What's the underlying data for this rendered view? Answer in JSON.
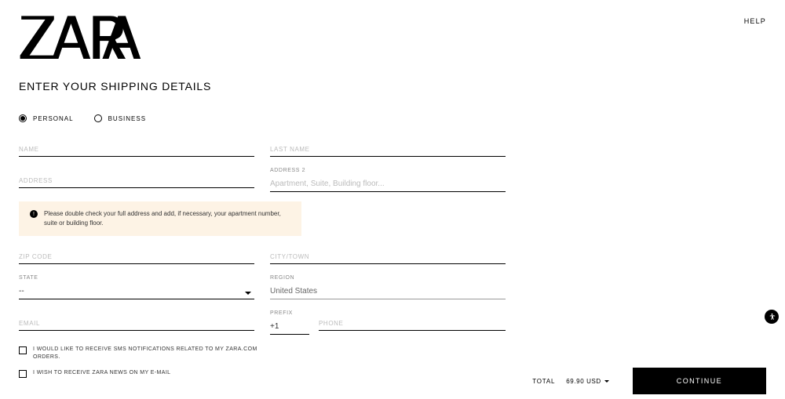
{
  "header": {
    "logo_text": "ZARA",
    "help": "HELP"
  },
  "page_title": "ENTER YOUR SHIPPING DETAILS",
  "account_type": {
    "personal": "PERSONAL",
    "business": "BUSINESS",
    "selected": "personal"
  },
  "fields": {
    "name_label": "NAME",
    "last_name_label": "LAST NAME",
    "address_label": "ADDRESS",
    "address2_label": "ADDRESS 2",
    "address2_placeholder": "Apartment, Suite, Building floor...",
    "zip_label": "ZIP CODE",
    "city_label": "CITY/TOWN",
    "state_label": "STATE",
    "state_value": "--",
    "region_label": "REGION",
    "region_value": "United States",
    "email_label": "EMAIL",
    "prefix_label": "PREFIX",
    "prefix_value": "+1",
    "phone_label": "PHONE"
  },
  "warning": "Please double check your full address and add, if necessary, your apartment number, suite or building floor.",
  "checkboxes": {
    "sms": "I WOULD LIKE TO RECEIVE SMS NOTIFICATIONS RELATED TO MY ZARA.COM ORDERS.",
    "news": "I WISH TO RECEIVE ZARA NEWS ON MY E-MAIL"
  },
  "footer": {
    "total_label": "TOTAL",
    "total_value": "69.90 USD",
    "continue": "CONTINUE"
  }
}
